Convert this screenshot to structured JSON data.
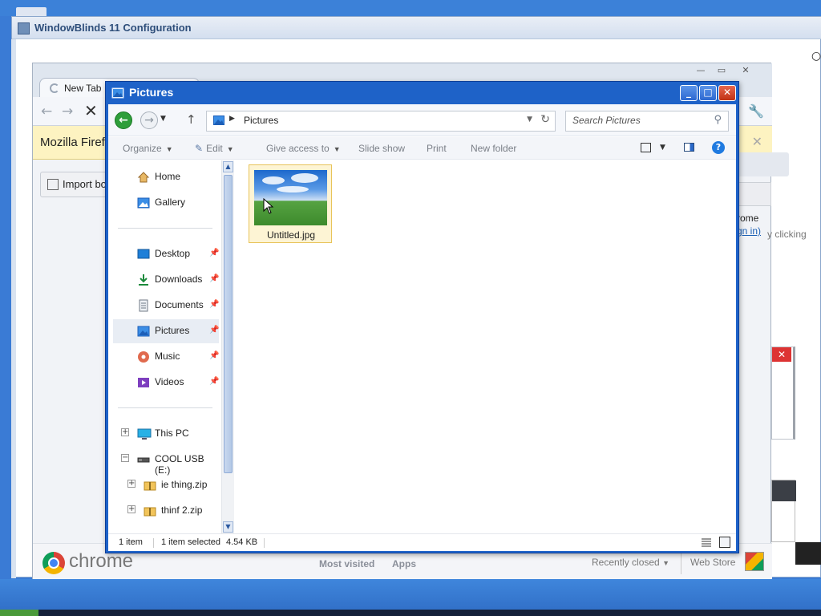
{
  "desktop": {
    "accent": "#3a7bd5"
  },
  "windowblinds": {
    "title": "WindowBlinds 11 Configuration",
    "icon": "app-icon"
  },
  "chrome": {
    "tab_label": "New Tab",
    "infobar_text": "Mozilla Firefo",
    "import_label": "Import bo",
    "right_text_1": "rome",
    "right_text_2": "gn in)",
    "right_text_3": "y clicking",
    "brand": "chrome",
    "tabs": [
      "Most visited",
      "Apps"
    ],
    "recently_closed": "Recently closed",
    "web_store": "Web Store"
  },
  "explorer": {
    "title": "Pictures",
    "address": "Pictures",
    "search_placeholder": "Search Pictures",
    "commands": {
      "organize": "Organize",
      "edit": "Edit",
      "give_access": "Give access to",
      "slideshow": "Slide show",
      "print": "Print",
      "new_folder": "New folder"
    },
    "nav": {
      "home": "Home",
      "gallery": "Gallery",
      "desktop": "Desktop",
      "downloads": "Downloads",
      "documents": "Documents",
      "pictures": "Pictures",
      "music": "Music",
      "videos": "Videos",
      "this_pc": "This PC",
      "usb": "COOL USB (E:)",
      "zip1": "ie thing.zip",
      "zip2": "thinf 2.zip"
    },
    "file": {
      "name": "Untitled.jpg"
    },
    "status": {
      "count": "1 item",
      "selected": "1 item selected",
      "size": "4.54 KB"
    }
  }
}
